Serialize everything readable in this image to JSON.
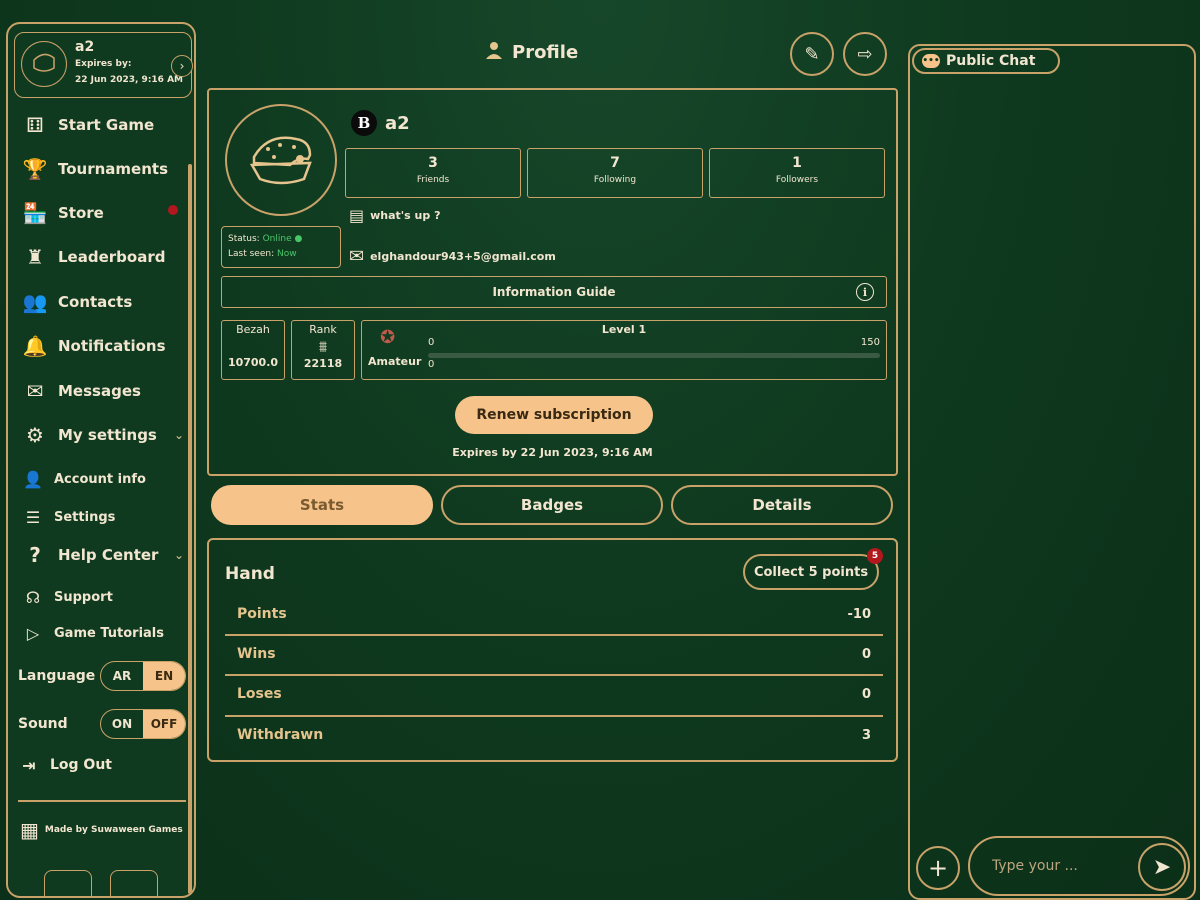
{
  "user": {
    "name": "a2",
    "expires_label": "Expires by:",
    "expires_date": "22 Jun 2023, 9:16 AM",
    "status_label": "Status:",
    "status_value": "Online",
    "last_seen_label": "Last seen:",
    "last_seen_value": "Now",
    "mood": "what's up ?",
    "email": "elghandour943+5@gmail.com",
    "badge_letter": "B"
  },
  "sidebar": {
    "items": [
      {
        "label": "Start Game",
        "icon": "start-game-icon",
        "glyph": "⚅"
      },
      {
        "label": "Tournaments",
        "icon": "trophy-icon",
        "glyph": "🏆"
      },
      {
        "label": "Store",
        "icon": "store-icon",
        "glyph": "🏪"
      },
      {
        "label": "Leaderboard",
        "icon": "leaderboard-icon",
        "glyph": "♜"
      },
      {
        "label": "Contacts",
        "icon": "contacts-icon",
        "glyph": "👥"
      },
      {
        "label": "Notifications",
        "icon": "bell-icon",
        "glyph": "🔔"
      },
      {
        "label": "Messages",
        "icon": "envelope-icon",
        "glyph": "✉"
      },
      {
        "label": "My settings",
        "icon": "gear-icon",
        "glyph": "⚙"
      },
      {
        "label": "Account info",
        "icon": "account-icon",
        "glyph": "👤"
      },
      {
        "label": "Settings",
        "icon": "sliders-icon",
        "glyph": "☰"
      },
      {
        "label": "Help Center",
        "icon": "question-icon",
        "glyph": "?"
      },
      {
        "label": "Support",
        "icon": "headset-icon",
        "glyph": "☊"
      },
      {
        "label": "Game Tutorials",
        "icon": "play-icon",
        "glyph": "▷"
      }
    ],
    "language_label": "Language",
    "language_options": [
      "AR",
      "EN"
    ],
    "language_selected": "EN",
    "sound_label": "Sound",
    "sound_options": [
      "ON",
      "OFF"
    ],
    "sound_selected": "OFF",
    "logout_label": "Log Out",
    "made_by": "Made by Suwaween Games"
  },
  "header": {
    "title": "Profile"
  },
  "profile": {
    "stats": [
      {
        "value": "3",
        "label": "Friends"
      },
      {
        "value": "7",
        "label": "Following"
      },
      {
        "value": "1",
        "label": "Followers"
      }
    ],
    "info_guide": "Information Guide",
    "bezah_label": "Bezah",
    "bezah_value": "10700.0",
    "rank_label": "Rank",
    "rank_value": "22118",
    "level_title": "Amateur",
    "level_label": "Level 1",
    "level_min": "0",
    "level_max": "150",
    "level_current": "0",
    "level_progress": 0,
    "renew_label": "Renew subscription",
    "expires_text": "Expires by 22 Jun 2023, 9:16 AM"
  },
  "tabs": [
    {
      "label": "Stats",
      "active": true
    },
    {
      "label": "Badges",
      "active": false
    },
    {
      "label": "Details",
      "active": false
    }
  ],
  "stats_panel": {
    "title": "Hand",
    "collect_label": "Collect 5 points",
    "collect_badge": "5",
    "rows": [
      {
        "label": "Points",
        "value": "-10"
      },
      {
        "label": "Wins",
        "value": "0"
      },
      {
        "label": "Loses",
        "value": "0"
      },
      {
        "label": "Withdrawn",
        "value": "3"
      }
    ]
  },
  "chat": {
    "title": "Public Chat",
    "placeholder": "Type your ..."
  },
  "colors": {
    "background": "#0f3a1f",
    "accent": "#c9a26a",
    "button_fill": "#f6c48a",
    "online": "#4ac66a",
    "alert": "#b1171d"
  }
}
